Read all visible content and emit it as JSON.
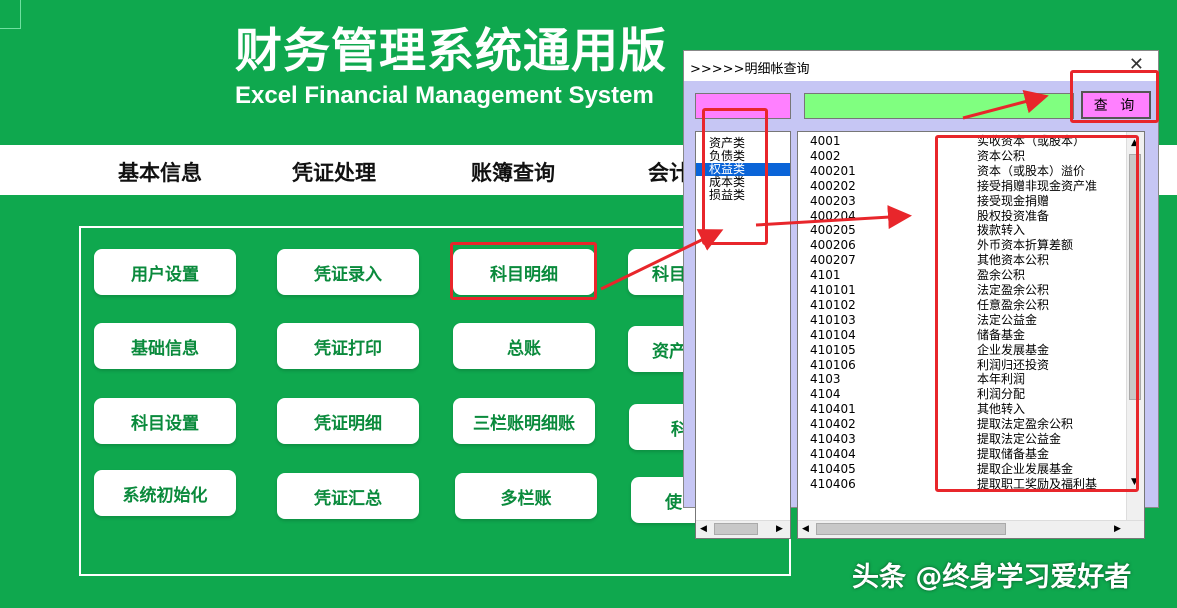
{
  "header": {
    "title_cn": "财务管理系统通用版",
    "title_en": "Excel Financial Management System"
  },
  "nav": [
    "基本信息",
    "凭证处理",
    "账簿查询",
    "会计"
  ],
  "buttons": {
    "col1": [
      "用户设置",
      "基础信息",
      "科目设置",
      "系统初始化"
    ],
    "col2": [
      "凭证录入",
      "凭证打印",
      "凭证明细",
      "凭证汇总"
    ],
    "col3": [
      "科目明细",
      "总账",
      "三栏账明细账",
      "多栏账"
    ],
    "col4": [
      "科目",
      "资产",
      "科",
      "使"
    ]
  },
  "dialog": {
    "title": ">>>>>明细帐查询",
    "close": "✕",
    "query_label": "查 询",
    "categories": [
      "资产类",
      "负债类",
      "权益类",
      "成本类",
      "损益类"
    ],
    "selected_category": "权益类",
    "accounts": [
      {
        "code": "4001",
        "name": "实收资本（或股本）"
      },
      {
        "code": "4002",
        "name": "资本公积"
      },
      {
        "code": "400201",
        "name": "资本（或股本）溢价"
      },
      {
        "code": "400202",
        "name": "接受捐赠非现金资产准"
      },
      {
        "code": "400203",
        "name": "接受现金捐赠"
      },
      {
        "code": "400204",
        "name": "股权投资准备"
      },
      {
        "code": "400205",
        "name": "拨款转入"
      },
      {
        "code": "400206",
        "name": "外币资本折算差额"
      },
      {
        "code": "400207",
        "name": "其他资本公积"
      },
      {
        "code": "4101",
        "name": "盈余公积"
      },
      {
        "code": "410101",
        "name": "法定盈余公积"
      },
      {
        "code": "410102",
        "name": "任意盈余公积"
      },
      {
        "code": "410103",
        "name": "法定公益金"
      },
      {
        "code": "410104",
        "name": "储备基金"
      },
      {
        "code": "410105",
        "name": "企业发展基金"
      },
      {
        "code": "410106",
        "name": "利润归还投资"
      },
      {
        "code": "4103",
        "name": "本年利润"
      },
      {
        "code": "4104",
        "name": "利润分配"
      },
      {
        "code": "410401",
        "name": "其他转入"
      },
      {
        "code": "410402",
        "name": "提取法定盈余公积"
      },
      {
        "code": "410403",
        "name": "提取法定公益金"
      },
      {
        "code": "410404",
        "name": "提取储备基金"
      },
      {
        "code": "410405",
        "name": "提取企业发展基金"
      },
      {
        "code": "410406",
        "name": "提取职工奖励及福利基"
      }
    ]
  },
  "watermark": "头条 @终身学习爱好者",
  "colors": {
    "background": "#0fa84e",
    "highlight": "#e8262b",
    "pink": "#ff80ff",
    "green": "#80ff80"
  }
}
